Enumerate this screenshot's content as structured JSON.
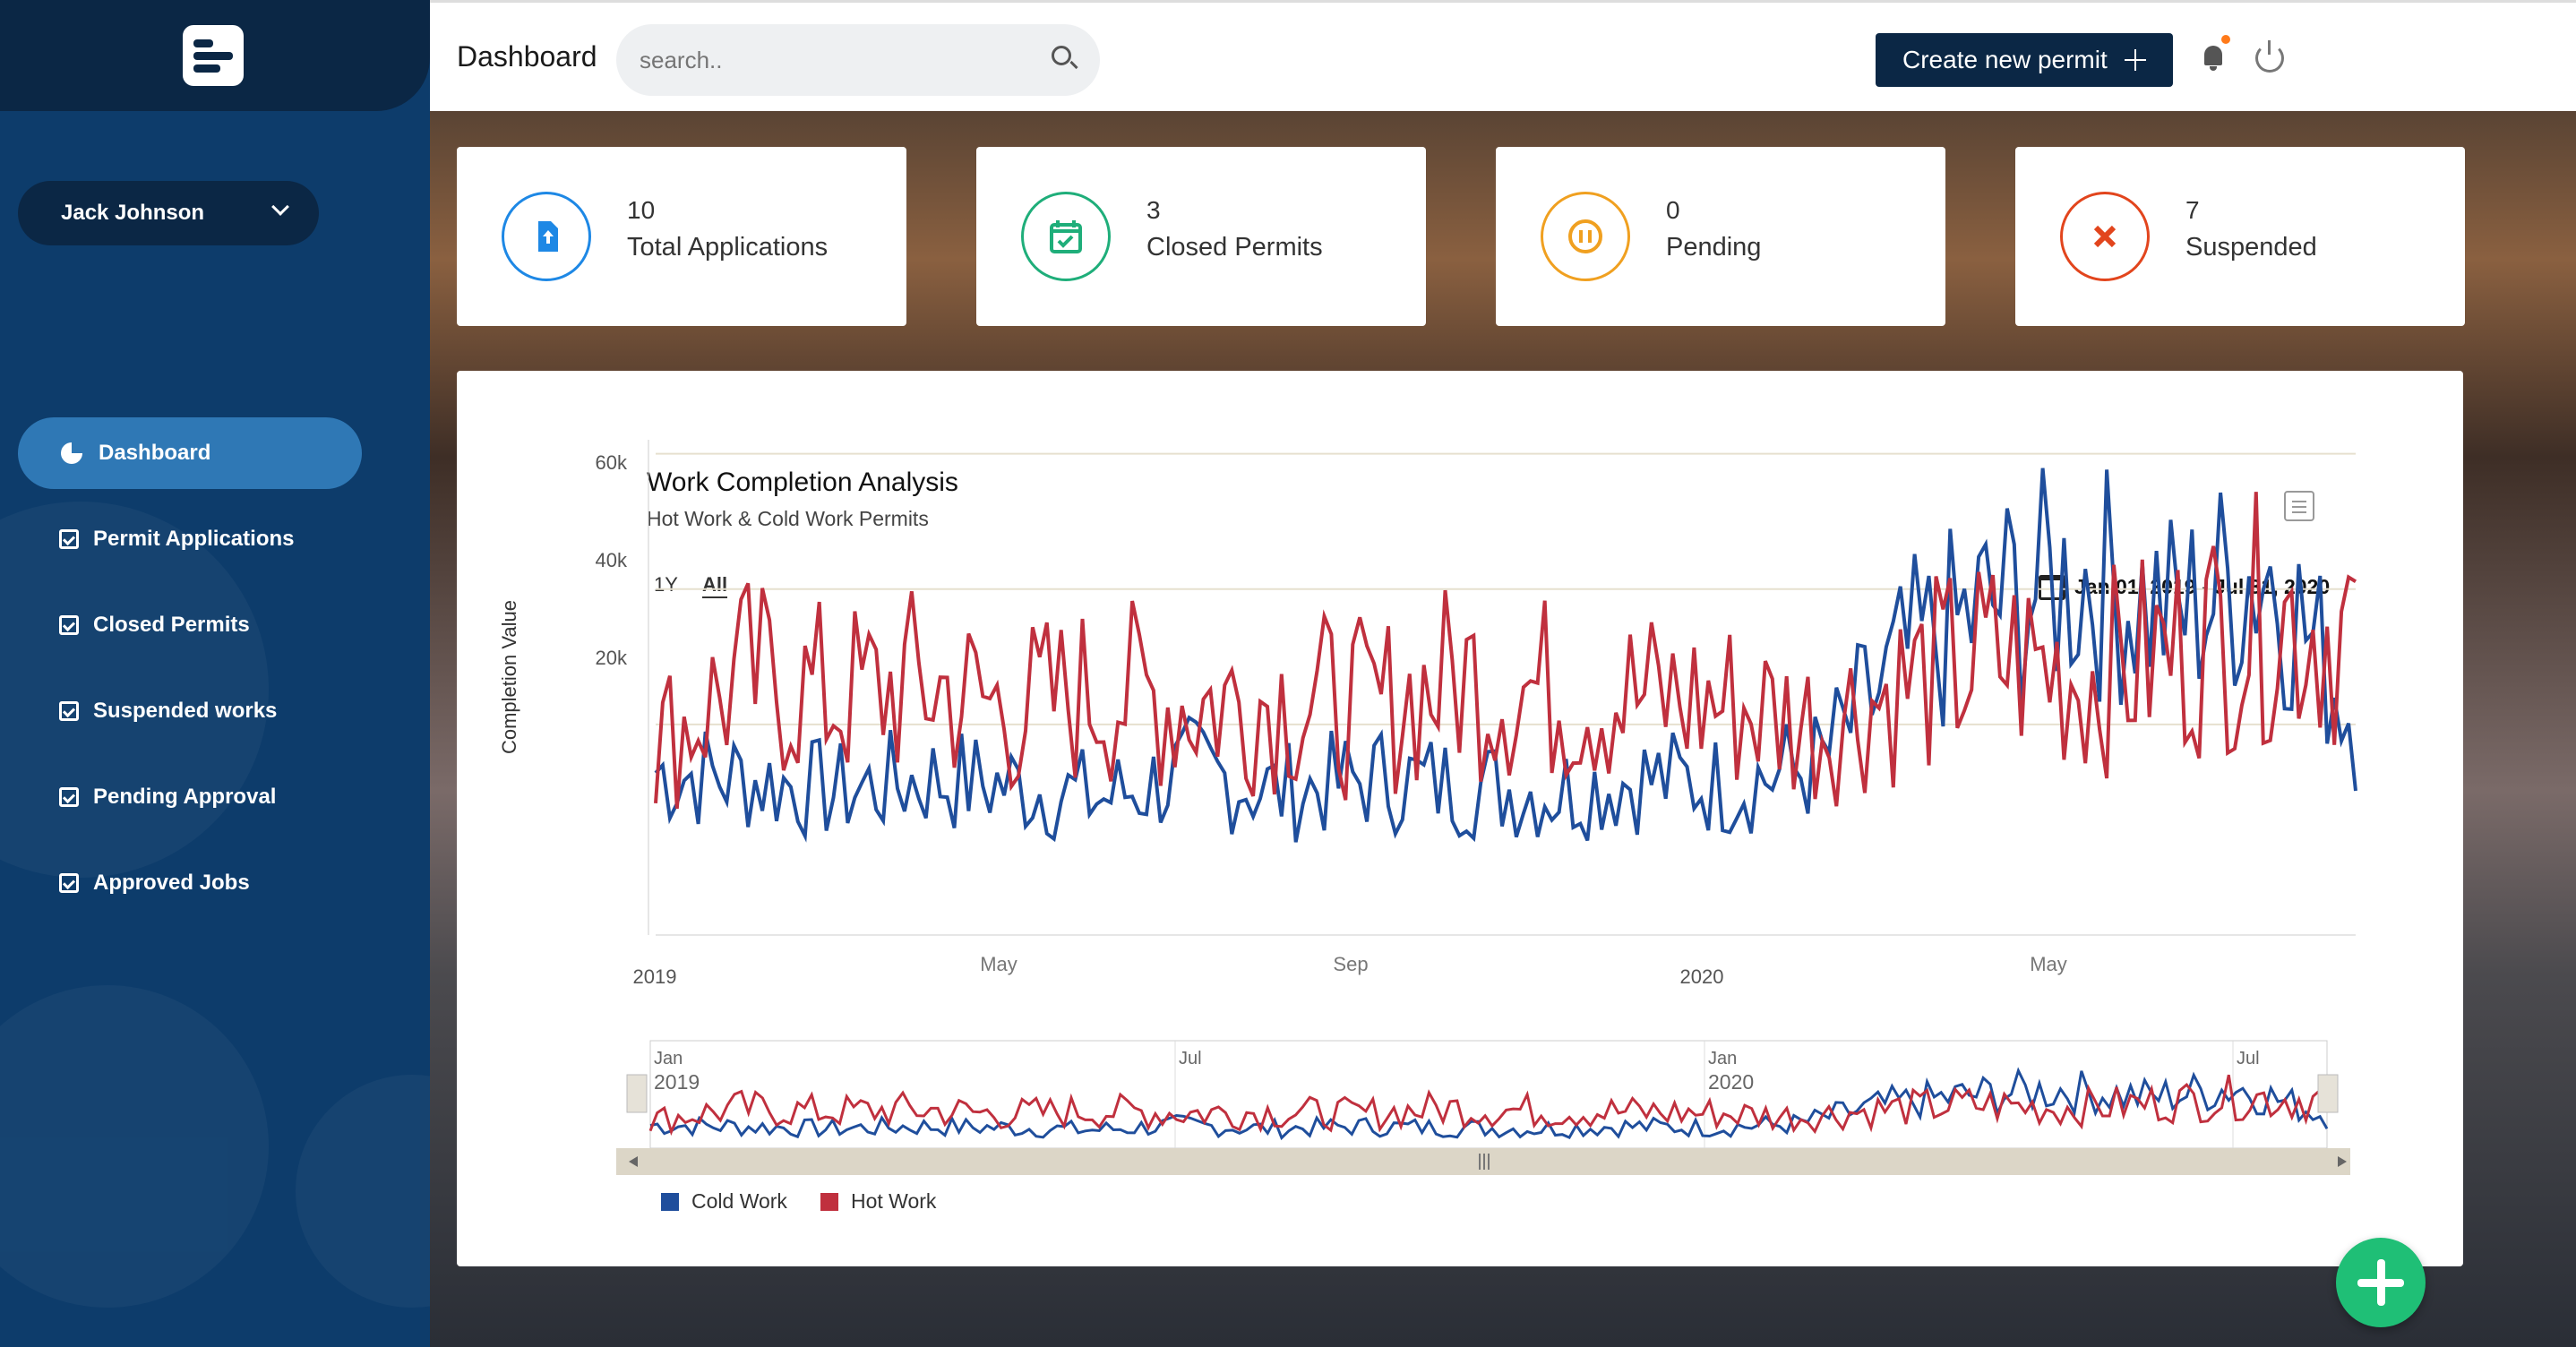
{
  "sidebar": {
    "user_name": "Jack Johnson",
    "nav": [
      {
        "label": "Dashboard",
        "icon": "pie-chart-icon",
        "active": true
      },
      {
        "label": "Permit Applications",
        "icon": "calendar-check-icon"
      },
      {
        "label": "Closed Permits",
        "icon": "calendar-check-icon"
      },
      {
        "label": "Suspended works",
        "icon": "calendar-check-icon"
      },
      {
        "label": "Pending Approval",
        "icon": "calendar-check-icon"
      },
      {
        "label": "Approved Jobs",
        "icon": "calendar-check-icon"
      }
    ]
  },
  "header": {
    "title": "Dashboard",
    "search_placeholder": "search..",
    "create_label": "Create new permit"
  },
  "stats": [
    {
      "value": "10",
      "label": "Total Applications",
      "color": "#1e88e5",
      "icon": "file-upload-icon"
    },
    {
      "value": "3",
      "label": "Closed Permits",
      "color": "#1fae7a",
      "icon": "calendar-check-icon"
    },
    {
      "value": "0",
      "label": "Pending",
      "color": "#f0a020",
      "icon": "pause-icon"
    },
    {
      "value": "7",
      "label": "Suspended",
      "color": "#e2451d",
      "icon": "close-x-icon"
    }
  ],
  "chart": {
    "title": "Work Completion Analysis",
    "subtitle": "Hot Work & Cold Work Permits",
    "zoom_options": [
      "1Y",
      "All"
    ],
    "zoom_selected": "All",
    "date_range": "Jan 01, 2019 - Jul 31, 2020",
    "ylabel": "Completion Value",
    "y_ticks": [
      "20k",
      "40k",
      "60k"
    ],
    "x_ticks": [
      "2019",
      "May",
      "Sep",
      "2020",
      "May"
    ],
    "nav_ticks_top": [
      "Jan",
      "Jul",
      "Jan",
      "Jul"
    ],
    "nav_ticks_bottom": [
      "2019",
      "2020"
    ]
  },
  "chart_data": {
    "type": "line",
    "title": "Work Completion Analysis",
    "subtitle": "Hot Work & Cold Work Permits",
    "ylabel": "Completion Value",
    "ylim": [
      0,
      70000
    ],
    "x_range": [
      "2019-01-01",
      "2020-07-31"
    ],
    "x_sample_dates": [
      "2019-01-01",
      "2019-02-01",
      "2019-03-01",
      "2019-04-01",
      "2019-05-01",
      "2019-06-01",
      "2019-07-01",
      "2019-08-01",
      "2019-09-01",
      "2019-10-01",
      "2019-11-01",
      "2019-12-01",
      "2020-01-01",
      "2020-02-01",
      "2020-03-01",
      "2020-04-01",
      "2020-05-01",
      "2020-06-01",
      "2020-07-01",
      "2020-07-31"
    ],
    "series": [
      {
        "name": "Cold Work",
        "color": "#1f4e9c",
        "values": [
          13000,
          12000,
          10000,
          12000,
          11000,
          9000,
          13000,
          10000,
          12000,
          11000,
          10000,
          12000,
          11000,
          14000,
          30000,
          38000,
          42000,
          36000,
          44000,
          21000
        ]
      },
      {
        "name": "Hot Work",
        "color": "#c0303e",
        "values": [
          17000,
          27000,
          24000,
          26000,
          22000,
          25000,
          23000,
          24000,
          22000,
          27000,
          25000,
          24000,
          23000,
          20000,
          26000,
          30000,
          27000,
          31000,
          36000,
          34000
        ]
      }
    ]
  }
}
